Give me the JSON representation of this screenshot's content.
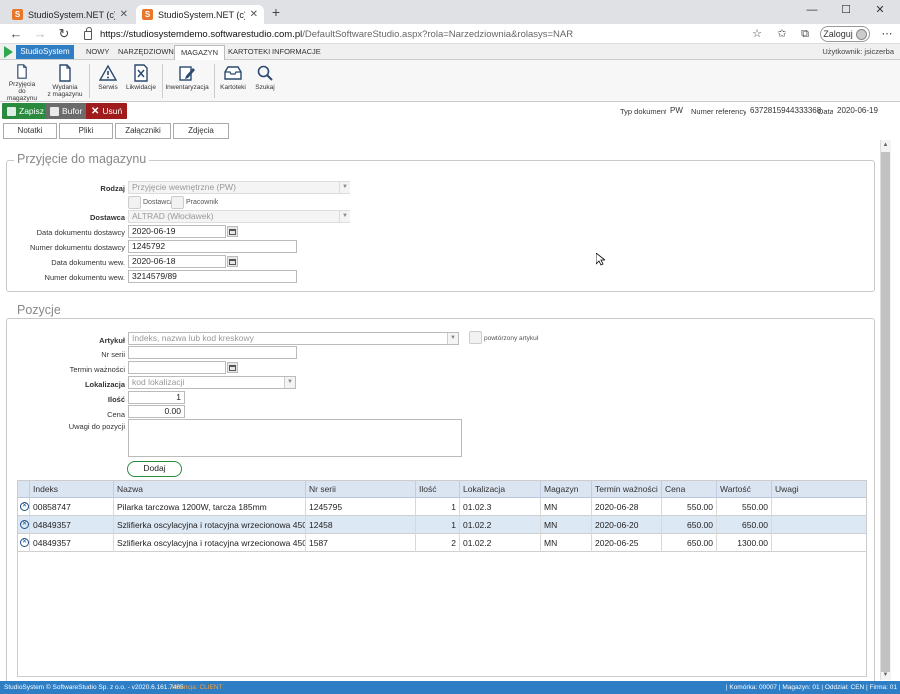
{
  "browser": {
    "tabs": [
      {
        "title": "StudioSystem.NET (c) SoftwareSt"
      },
      {
        "title": "StudioSystem.NET (c) SoftwareSt"
      }
    ],
    "new_tab": "+",
    "url_host": "https://studiosystemdemo.softwarestudio.com.pl",
    "url_path": "/DefaultSoftwareStudio.aspx?rola=Narzedziownia&rolasys=NAR",
    "login_label": "Zaloguj"
  },
  "menu": {
    "brand": "StudioSystem",
    "tabs": [
      "NOWY",
      "NARZĘDZIOWNIA",
      "MAGAZYN",
      "KARTOTEKI",
      "INFORMACJE"
    ],
    "active_index": 2,
    "user": "Użytkownik: jsiczerba"
  },
  "ribbon": {
    "items": [
      {
        "label1": "Przyjęcia",
        "label2": "do magazynu",
        "icon": "document-icon"
      },
      {
        "label1": "Wydania",
        "label2": "z magazynu",
        "icon": "document-icon"
      },
      {
        "label1": "Serwis",
        "label2": "",
        "icon": "warning-icon"
      },
      {
        "label1": "Likwidacje",
        "label2": "",
        "icon": "cancel-doc-icon"
      },
      {
        "label1": "Inwentaryzacja",
        "label2": "",
        "icon": "edit-icon"
      },
      {
        "label1": "Kartoteki",
        "label2": "",
        "icon": "inbox-icon"
      },
      {
        "label1": "Szukaj",
        "label2": "",
        "icon": "search-icon"
      }
    ]
  },
  "actions": {
    "save": "Zapisz",
    "buffer": "Bufor",
    "delete": "Usuń",
    "doc_type_label": "Typ dokumentu",
    "doc_type": "PW",
    "ref_label": "Numer referencyjny",
    "ref": "6372815944333368",
    "date_label": "Data",
    "date": "2020-06-19"
  },
  "subtabs": [
    "Notatki",
    "Pliki",
    "Załączniki",
    "Zdjęcia"
  ],
  "receipt": {
    "title": "Przyjęcie do magazynu",
    "rodzaj_label": "Rodzaj",
    "rodzaj": "Przyjęcie wewnętrzne (PW)",
    "chk_dostawca": "Dostawca",
    "chk_pracownik": "Pracownik",
    "dostawca_label": "Dostawca",
    "dostawca": "ALTRAD (Włocławek)",
    "data_dost_label": "Data dokumentu dostawcy",
    "data_dost": "2020-06-19",
    "nr_dost_label": "Numer dokumentu dostawcy",
    "nr_dost": "1245792",
    "data_wew_label": "Data dokumentu wew.",
    "data_wew": "2020-06-18",
    "nr_wew_label": "Numer dokumentu wew.",
    "nr_wew": "3214579/89"
  },
  "positions": {
    "title": "Pozycje",
    "artykul_label": "Artykuł",
    "artykul_ph": "Indeks, nazwa lub kod kreskowy",
    "repeat_label": "powtórzony artykuł",
    "nr_serii_label": "Nr serii",
    "termin_label": "Termin ważności",
    "lok_label": "Lokalizacja",
    "lok_ph": "kod lokalizacji",
    "ilosc_label": "Ilość",
    "ilosc": "1",
    "cena_label": "Cena",
    "cena": "0.00",
    "uwagi_label": "Uwagi do pozycji",
    "add_button": "Dodaj"
  },
  "grid": {
    "columns": [
      "Indeks",
      "Nazwa",
      "Nr serii",
      "Ilość",
      "Lokalizacja",
      "Magazyn",
      "Termin ważności",
      "Cena",
      "Wartość",
      "Uwagi"
    ],
    "rows": [
      [
        "00858747",
        "Pilarka tarczowa 1200W, tarcza 185mm",
        "1245795",
        "1",
        "01.02.3",
        "MN",
        "2020-06-28",
        "550.00",
        "550.00",
        ""
      ],
      [
        "04849357",
        "Szlifierka oscylacyjna i rotacyjna wrzecionowa 450...",
        "12458",
        "1",
        "01.02.2",
        "MN",
        "2020-06-20",
        "650.00",
        "650.00",
        ""
      ],
      [
        "04849357",
        "Szlifierka oscylacyjna i rotacyjna wrzecionowa 450...",
        "1587",
        "2",
        "01.02.2",
        "MN",
        "2020-06-25",
        "650.00",
        "1300.00",
        ""
      ]
    ],
    "selected_row": 1
  },
  "status": {
    "left": "StudioSystem © SoftwareStudio Sp. z o.o. - v2020.6.161.7465",
    "license": "Licencja: CLIENT",
    "right": "| Komórka: 00007 | Magazyn: 01 | Oddział: CEN | Firma: 01"
  }
}
